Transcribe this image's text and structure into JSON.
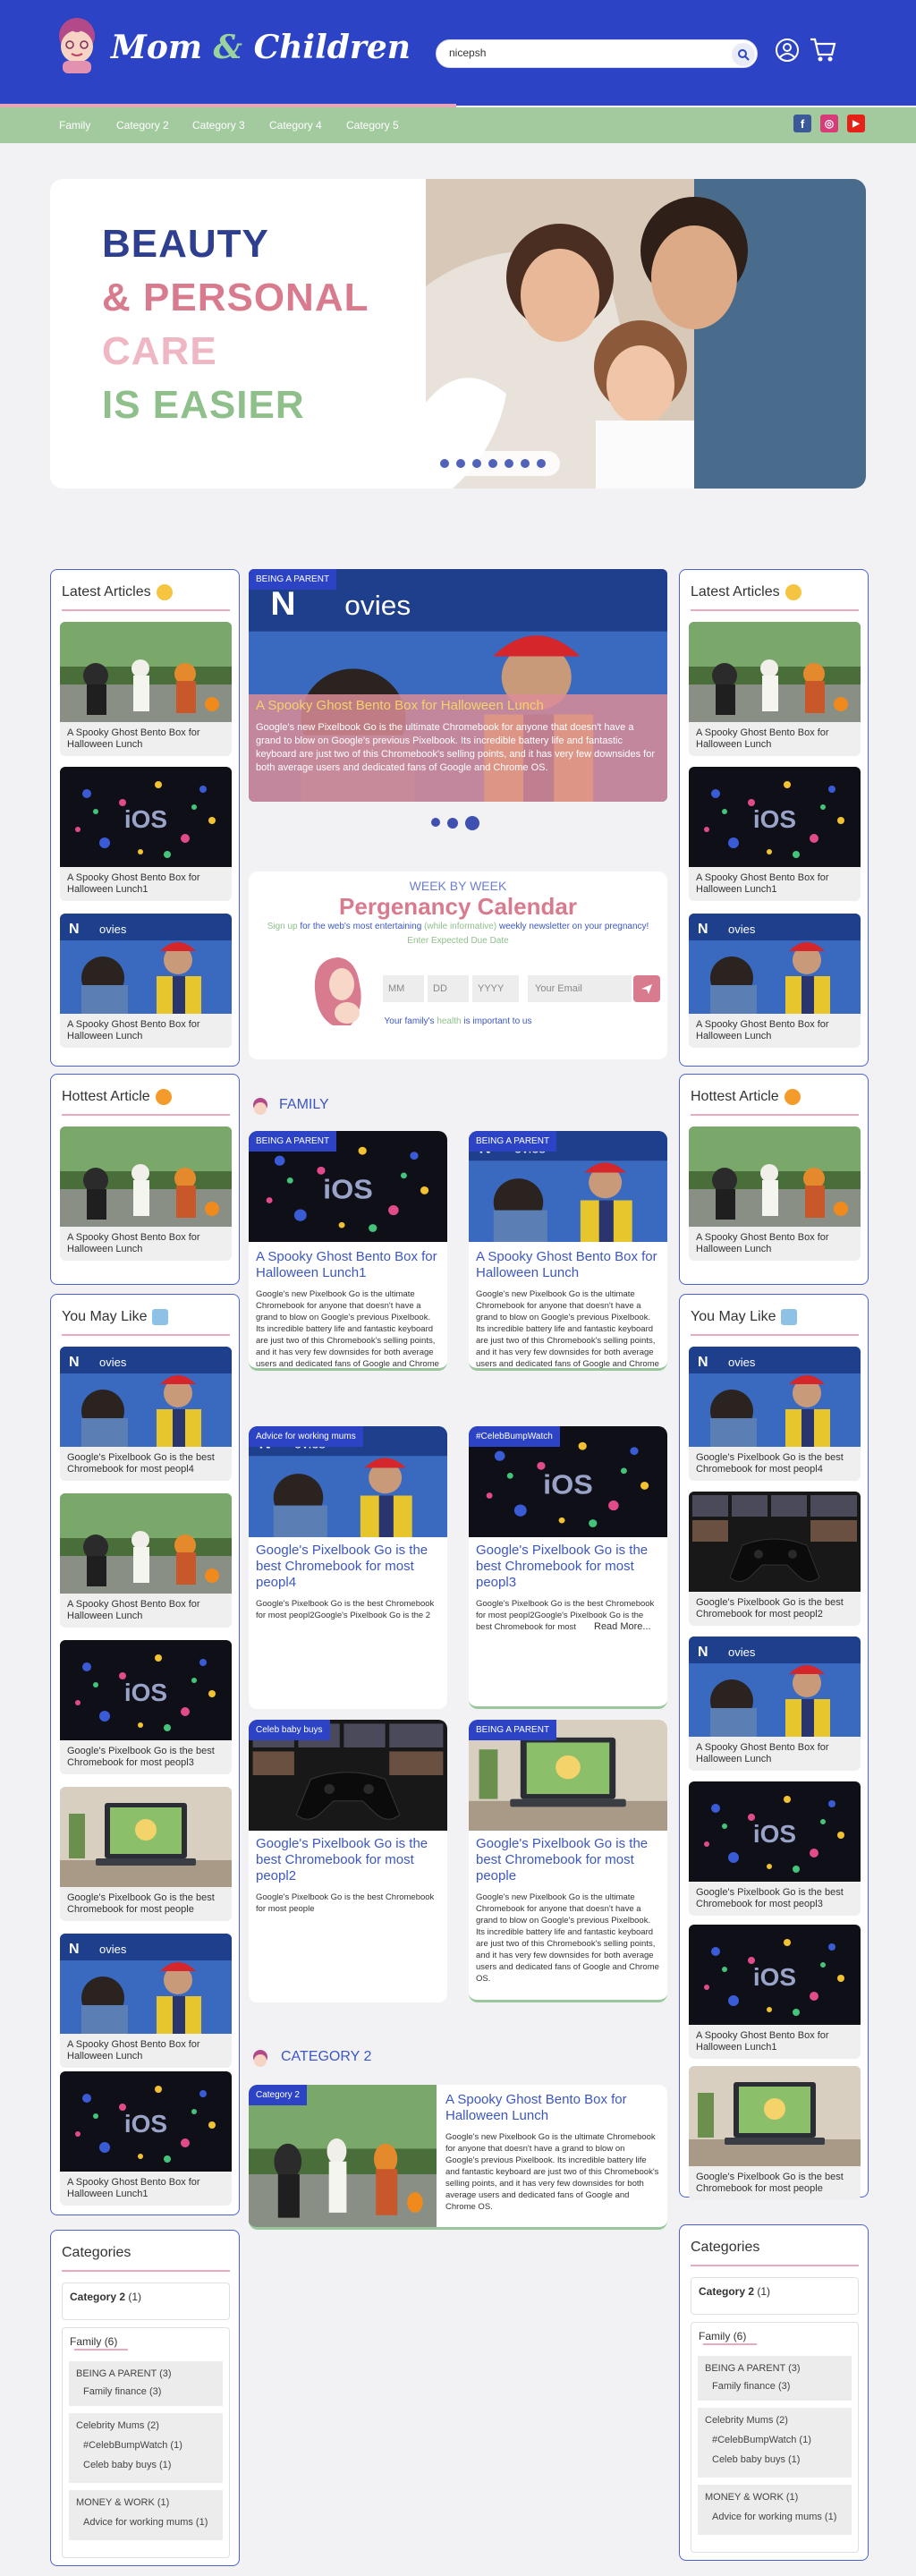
{
  "header": {
    "brand_part1": "Mom",
    "brand_amp": "&",
    "brand_part2": "Children",
    "search_value": "nicepsh",
    "search_icon": "search-icon",
    "user_icon": "user-icon",
    "cart_icon": "cart-icon"
  },
  "nav": {
    "items": [
      "Family",
      "Category 2",
      "Category 3",
      "Category 4",
      "Category 5"
    ]
  },
  "social": {
    "facebook": "f",
    "instagram": "◎",
    "youtube": "▶"
  },
  "hero": {
    "line1": "BEAUTY",
    "line2": "& PERSONAL",
    "line3": "CARE",
    "line4": "IS EASIER",
    "colors": {
      "line1": "#2f3f8f",
      "line2": "#d97b8e",
      "line3": "#efb6c4",
      "line4": "#8fbf8b"
    }
  },
  "left_latest": {
    "title": "Latest Articles",
    "items": [
      "A Spooky Ghost Bento Box for Halloween Lunch",
      "A Spooky Ghost Bento Box for Halloween Lunch1",
      "A Spooky Ghost Bento Box for Halloween Lunch"
    ]
  },
  "left_hottest": {
    "title": "Hottest Article",
    "items": [
      "A Spooky Ghost Bento Box for Halloween Lunch"
    ]
  },
  "left_may_like": {
    "title": "You May Like",
    "items": [
      "Google's Pixelbook Go is the best Chromebook for most peopl4",
      "A Spooky Ghost Bento Box for Halloween Lunch",
      "Google's Pixelbook Go is the best Chromebook for most peopl3",
      "Google's Pixelbook Go is the best Chromebook for most people",
      "A Spooky Ghost Bento Box for Halloween Lunch",
      "A Spooky Ghost Bento Box for Halloween Lunch1"
    ]
  },
  "left_categories": {
    "title": "Categories",
    "cat2": "Category 2",
    "cat2_count": "(1)",
    "family": "Family",
    "family_count": "(6)",
    "subs": [
      "BEING A PARENT (3)",
      "Family finance (3)",
      "Celebrity Mums (2)",
      "#CelebBumpWatch (1)",
      "Celeb baby buys (1)",
      "MONEY & WORK (1)",
      "Advice for working mums (1)"
    ]
  },
  "right_latest": {
    "title": "Latest Articles",
    "items": [
      "A Spooky Ghost Bento Box for Halloween Lunch",
      "A Spooky Ghost Bento Box for Halloween Lunch1",
      "A Spooky Ghost Bento Box for Halloween Lunch"
    ]
  },
  "right_hottest": {
    "title": "Hottest Article",
    "items": [
      "A Spooky Ghost Bento Box for Halloween Lunch"
    ]
  },
  "right_may_like": {
    "title": "You May Like",
    "items": [
      "Google's Pixelbook Go is the best Chromebook for most peopl4",
      "Google's Pixelbook Go is the best Chromebook for most peopl2",
      "A Spooky Ghost Bento Box for Halloween Lunch",
      "Google's Pixelbook Go is the best Chromebook for most peopl3",
      "A Spooky Ghost Bento Box for Halloween Lunch1",
      "Google's Pixelbook Go is the best Chromebook for most people"
    ]
  },
  "right_categories": {
    "title": "Categories",
    "cat2": "Category 2",
    "cat2_count": "(1)",
    "family": "Family",
    "family_count": "(6)",
    "subs": [
      "BEING A PARENT (3)",
      "Family finance (3)",
      "Celebrity Mums (2)",
      "#CelebBumpWatch (1)",
      "Celeb baby buys (1)",
      "MONEY & WORK (1)",
      "Advice for working mums (1)"
    ]
  },
  "featured": {
    "tag": "BEING A PARENT",
    "title": "A Spooky Ghost Bento Box for Halloween Lunch",
    "excerpt": "Google's new Pixelbook Go is the ultimate Chromebook for anyone that doesn't have a grand to blow on Google's previous Pixelbook. Its incredible battery life and fantastic keyboard are just two of this Chromebook's selling points, and it has very few downsides for both average users and dedicated fans of Google and Chrome OS."
  },
  "calendar": {
    "kicker": "WEEK BY WEEK",
    "title": "Pergenancy Calendar",
    "sub_link": "Sign up",
    "sub_text1": " for the web's most entertaining ",
    "sub_em": "(while informative)",
    "sub_text2": " weekly newsletter on your pregnancy!",
    "due": "Enter Expected Due Date",
    "mm": "MM",
    "dd": "DD",
    "yyyy": "YYYY",
    "email": "Your Email",
    "note1": "Your family's ",
    "note_em": "health",
    "note2": " is important to us"
  },
  "family_section": {
    "heading": "FAMILY",
    "cards": [
      {
        "tag": "BEING A PARENT",
        "title": "A Spooky Ghost Bento Box for Halloween Lunch1",
        "excerpt": "Google's new Pixelbook Go is the ultimate Chromebook for anyone that doesn't have a grand to blow on Google's previous Pixelbook. Its incredible battery life and fantastic keyboard are just two of this Chromebook's selling points, and it has very few downsides for both average users and dedicated fans of Google and Chrome OS."
      },
      {
        "tag": "BEING A PARENT",
        "title": "A Spooky Ghost Bento Box for Halloween Lunch",
        "excerpt": "Google's new Pixelbook Go is the ultimate Chromebook for anyone that doesn't have a grand to blow on Google's previous Pixelbook. Its incredible battery life and fantastic keyboard are just two of this Chromebook's selling points, and it has very few downsides for both average users and dedicated fans of Google and Chrome OS."
      },
      {
        "tag": "Advice for working mums",
        "title": "Google's Pixelbook Go is the best Chromebook for most peopl4",
        "excerpt": "Google's Pixelbook Go is the best Chromebook for most peopl2Google's Pixelbook Go is the 2"
      },
      {
        "tag": "#CelebBumpWatch",
        "title": "Google's Pixelbook Go is the best Chromebook for most peopl3",
        "excerpt": "Google's Pixelbook Go is the best Chromebook for most peopl2Google's Pixelbook Go is the best Chromebook for most",
        "more": "Read More..."
      },
      {
        "tag": "Celeb baby buys",
        "title": "Google's Pixelbook Go is the best Chromebook for most peopl2",
        "excerpt": "Google's Pixelbook Go is the best Chromebook for most people"
      },
      {
        "tag": "BEING A PARENT",
        "title": "Google's Pixelbook Go is the best Chromebook for most people",
        "excerpt": "Google's new Pixelbook Go is the ultimate Chromebook for anyone that doesn't have a grand to blow on Google's previous Pixelbook. Its incredible battery life and fantastic keyboard are just two of this Chromebook's selling points, and it has very few downsides for both average users and dedicated fans of Google and Chrome OS."
      }
    ]
  },
  "category2_section": {
    "heading": "CATEGORY 2",
    "tag": "Category 2",
    "title": "A Spooky Ghost Bento Box for Halloween Lunch",
    "excerpt": "Google's new Pixelbook Go is the ultimate Chromebook for anyone that doesn't have a grand to blow on Google's previous Pixelbook. Its incredible battery life and fantastic keyboard are just two of this Chromebook's selling points, and it has very few downsides for both average users and dedicated fans of Google and Chrome OS."
  }
}
